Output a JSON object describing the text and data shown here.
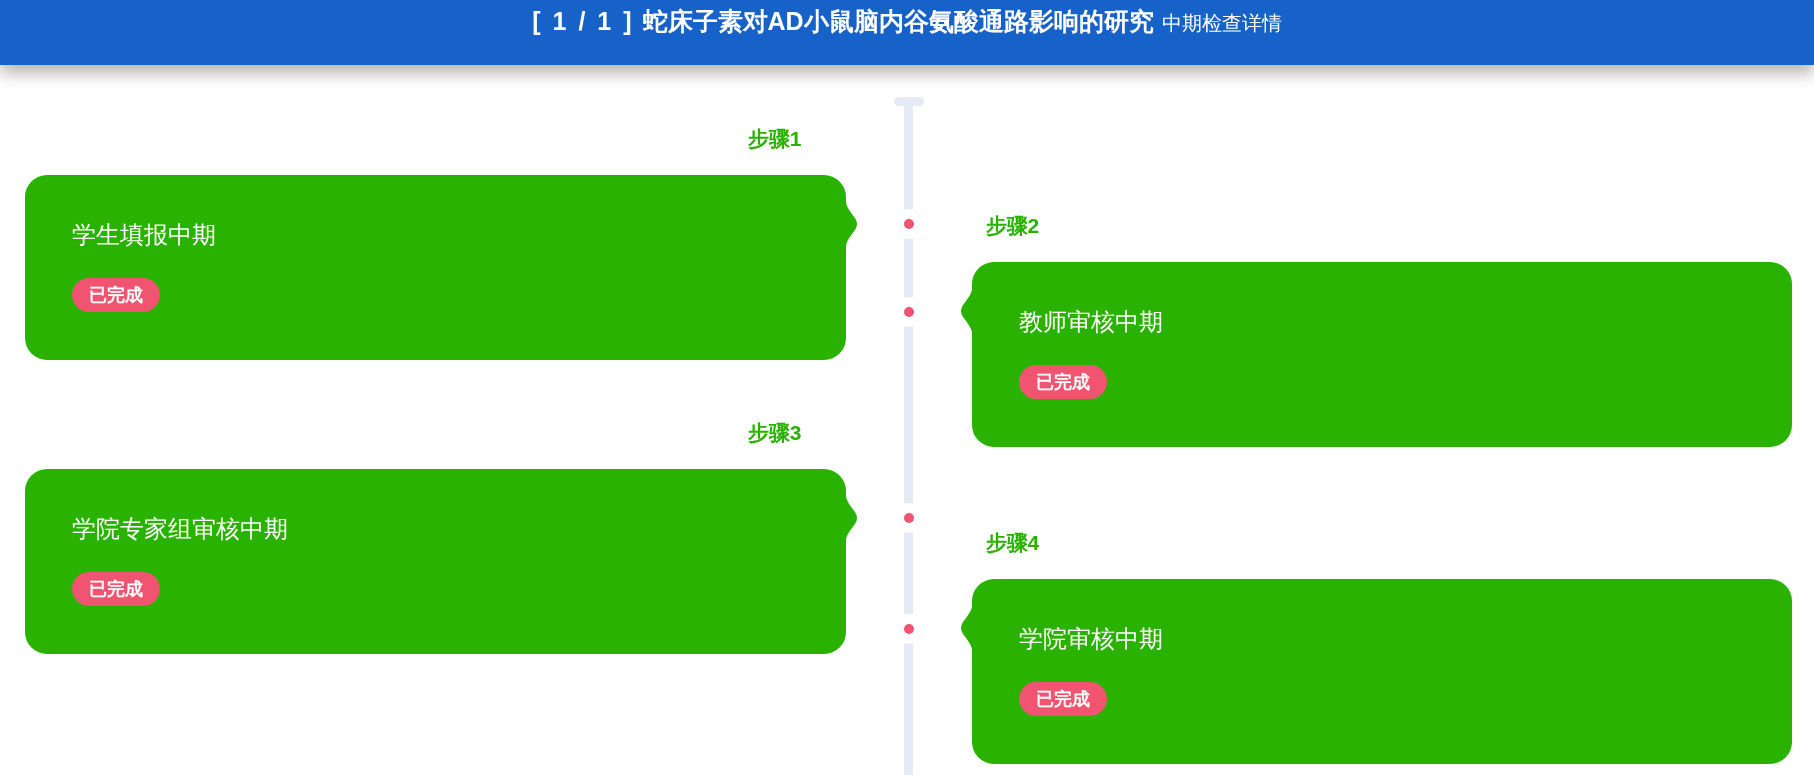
{
  "header": {
    "counter": "[ 1 / 1 ]",
    "title": "蛇床子素对AD小鼠脑内谷氨酸通路影响的研究",
    "subtitle": "中期检查详情"
  },
  "steps": [
    {
      "label": "步骤1",
      "title": "学生填报中期",
      "status": "已完成",
      "done": true
    },
    {
      "label": "步骤2",
      "title": "教师审核中期",
      "status": "已完成",
      "done": true
    },
    {
      "label": "步骤3",
      "title": "学院专家组审核中期",
      "status": "已完成",
      "done": true
    },
    {
      "label": "步骤4",
      "title": "学院审核中期",
      "status": "已完成",
      "done": true
    }
  ]
}
